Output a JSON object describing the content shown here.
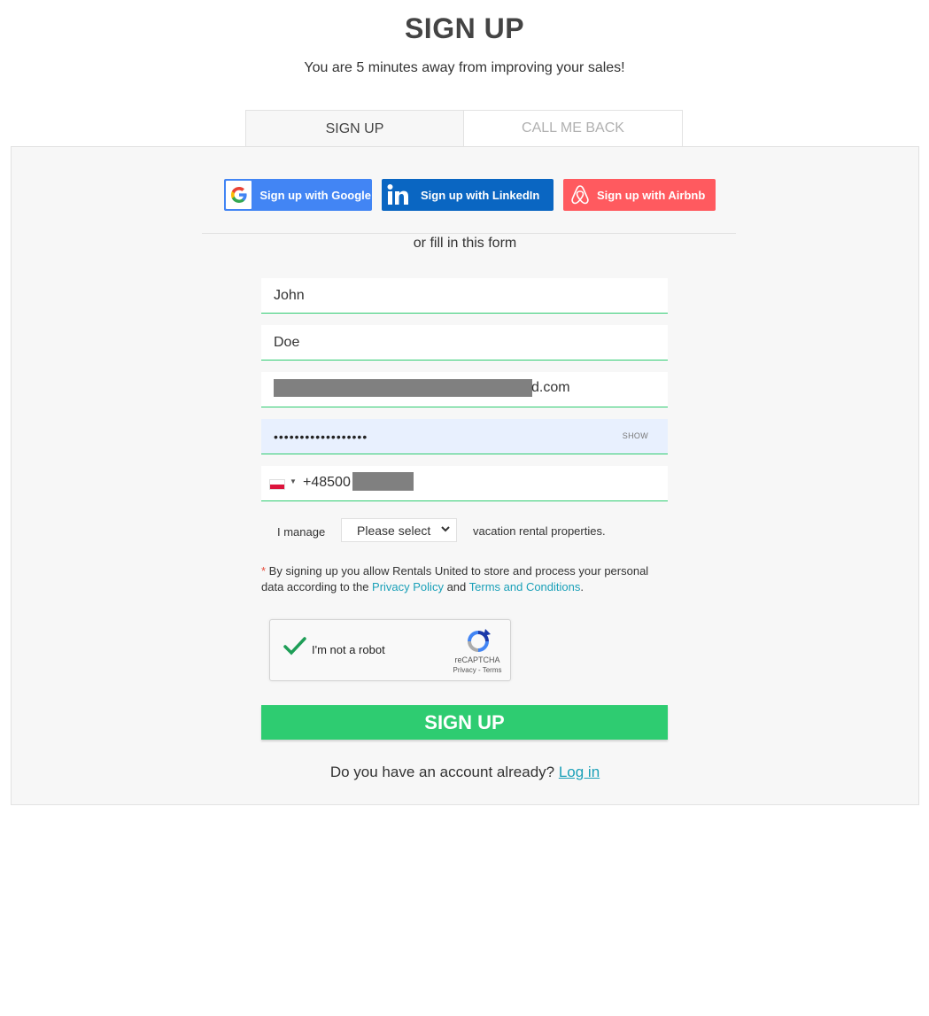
{
  "header": {
    "title": "SIGN UP",
    "subtitle": "You are 5 minutes away from improving your sales!"
  },
  "tabs": [
    {
      "label": "SIGN UP",
      "active": true
    },
    {
      "label": "CALL ME BACK",
      "active": false
    }
  ],
  "social": {
    "google": {
      "label": "Sign up with Google",
      "icon": "google-icon",
      "color": "#4285f4"
    },
    "linkedin": {
      "label": "Sign up with LinkedIn",
      "icon": "linkedin-icon",
      "color": "#0a66c2"
    },
    "airbnb": {
      "label": "Sign up with Airbnb",
      "icon": "airbnb-icon",
      "color": "#ff5a5f"
    }
  },
  "or_text": "or fill in this form",
  "form": {
    "first_name": "John",
    "last_name": "Doe",
    "email_visible_suffix": "d.com",
    "password_masked": "••••••••••••••••••",
    "show_label": "SHOW",
    "phone": {
      "country_flag": "flag-poland-icon",
      "prefix": "+48500"
    },
    "manage_prefix": "I manage",
    "manage_select": "Please select",
    "manage_suffix": "vacation rental properties.",
    "consent": {
      "star": "*",
      "text_before": " By signing up you allow Rentals United to store and process your personal data according to the ",
      "privacy_link": "Privacy Policy",
      "and": " and ",
      "terms_link": "Terms and Conditions",
      "end": "."
    },
    "captcha": {
      "label": "I'm not a robot",
      "brand": "reCAPTCHA",
      "links": "Privacy - Terms",
      "checked": true
    },
    "submit_label": "SIGN UP"
  },
  "login": {
    "question": "Do you have an account already? ",
    "link": "Log in"
  },
  "colors": {
    "accent": "#2ecc71",
    "link": "#1aa0b8",
    "panel_bg": "#f7f7f7"
  }
}
